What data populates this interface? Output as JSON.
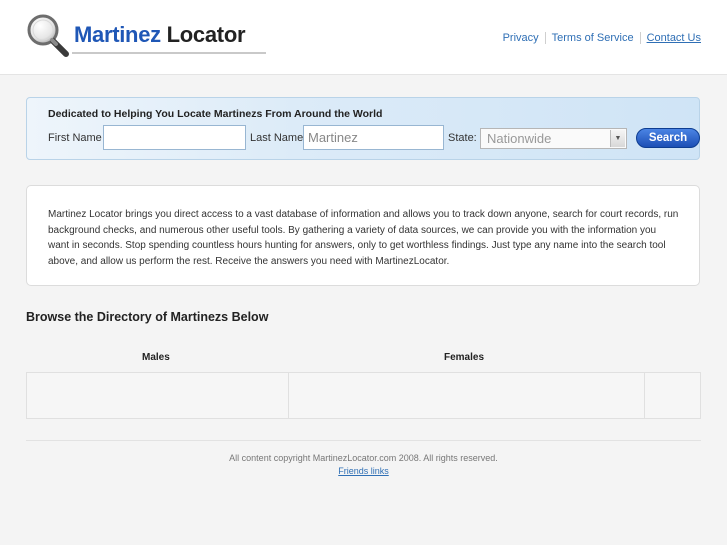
{
  "header": {
    "logo_brand": "Martinez",
    "logo_rest": "Locator",
    "nav": [
      "Privacy",
      "Terms of Service",
      "Contact Us"
    ]
  },
  "search": {
    "tagline": "Dedicated to Helping You Locate Martinezs From Around the World",
    "first_name_label": "First Name",
    "first_name_value": "",
    "last_name_label": "Last Name",
    "last_name_value": "Martinez",
    "state_label": "State:",
    "state_value": "Nationwide",
    "button_label": "Search"
  },
  "intro": {
    "text": "Martinez Locator brings you direct access to a vast database of information and allows you to track down anyone, search for court records, run background checks, and numerous other useful tools. By gathering a variety of data sources, we can provide you with the information you want in seconds. Stop spending countless hours hunting for answers, only to get worthless findings. Just type any name into the search tool above, and allow us perform the rest. Receive the answers you need with MartinezLocator."
  },
  "directory": {
    "title": "Browse the Directory of Martinezs Below",
    "columns": [
      "Males",
      "Females"
    ]
  },
  "footer": {
    "copyright": "All content copyright MartinezLocator.com 2008. All rights reserved.",
    "link": "Friends links"
  },
  "colors": {
    "brand": "#1f57b6",
    "link": "#2f6fb5",
    "button": "#1c4fb5"
  }
}
